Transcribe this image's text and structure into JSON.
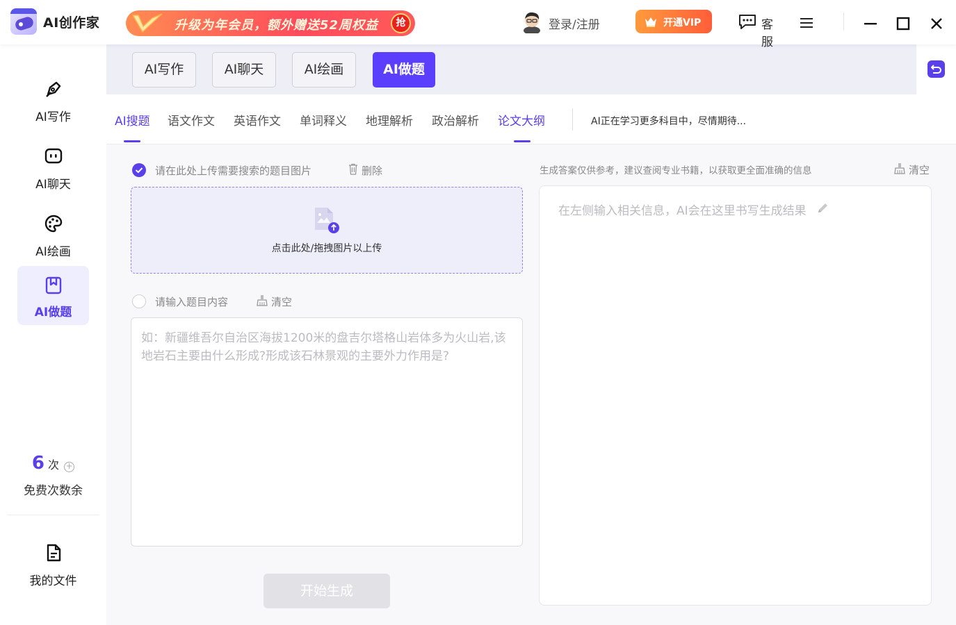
{
  "app": {
    "name": "AI创作家"
  },
  "promo": {
    "text": "升级为年会员，额外赠送52周权益",
    "badge": "抢"
  },
  "header": {
    "login": "登录/注册",
    "vip": "开通VIP",
    "service": "客服"
  },
  "sidebar": {
    "items": [
      {
        "label": "AI写作",
        "icon": "pen-nib-icon"
      },
      {
        "label": "AI聊天",
        "icon": "chat-bubble-icon"
      },
      {
        "label": "AI绘画",
        "icon": "palette-icon"
      },
      {
        "label": "AI做题",
        "icon": "bookmark-book-icon",
        "active": true
      }
    ],
    "free_count": {
      "number": "6",
      "unit": "次",
      "label": "免费次数余"
    },
    "files": {
      "label": "我的文件",
      "icon": "document-icon"
    }
  },
  "mode_tabs": [
    {
      "label": "AI写作"
    },
    {
      "label": "AI聊天"
    },
    {
      "label": "AI绘画"
    },
    {
      "label": "AI做题",
      "active": true
    }
  ],
  "subtabs": [
    {
      "label": "AI搜题",
      "active": true
    },
    {
      "label": "语文作文"
    },
    {
      "label": "英语作文"
    },
    {
      "label": "单词释义"
    },
    {
      "label": "地理解析"
    },
    {
      "label": "政治解析"
    },
    {
      "label": "论文大纲",
      "active": true
    }
  ],
  "subtab_note": "AI正在学习更多科目中，尽情期待...",
  "upload": {
    "label": "请在此处上传需要搜索的题目图片",
    "delete": "删除",
    "hint": "点击此处/拖拽图片以上传"
  },
  "text_input": {
    "label": "请输入题目内容",
    "clear": "清空",
    "placeholder": "如：新疆维吾尔自治区海拔1200米的盘吉尔塔格山岩体多为火山岩,该地岩石主要由什么形成?形成该石林景观的主要外力作用是?",
    "value": ""
  },
  "generate_button": "开始生成",
  "result": {
    "note": "生成答案仅供参考，建议查阅专业书籍，以获取更全面准确的信息",
    "clear": "清空",
    "placeholder": "在左侧输入相关信息，AI会在这里书写生成结果"
  },
  "colors": {
    "accent": "#5a40ea",
    "vip": "#ff6a3c",
    "promo": "#ff4b5c"
  }
}
